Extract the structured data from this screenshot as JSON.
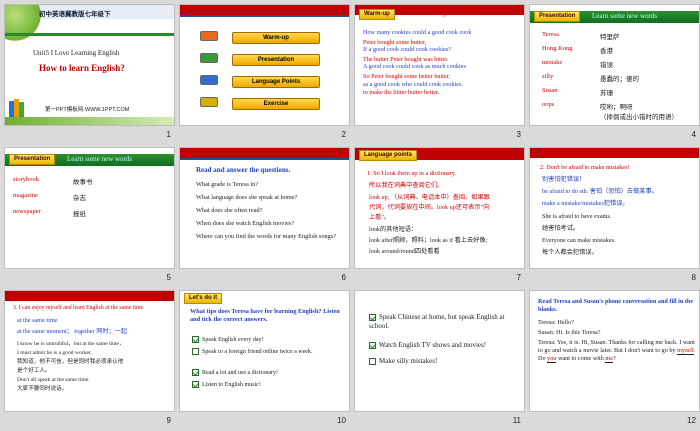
{
  "slides": [
    {
      "number": "1",
      "banner": "初中英语冀教版七年级下",
      "unit": "Unit5 I Love Learning English",
      "title": "How to learn English?",
      "footer": "第一PPT模板网-WWW.1PPT.COM"
    },
    {
      "number": "2",
      "menu": [
        "Warm-up",
        "Presentation",
        "Language Points",
        "Exercise"
      ]
    },
    {
      "number": "3",
      "tag": "Warm-up",
      "heading": "Tongue Twister",
      "lines": [
        "How many cookies could a good cook cook",
        "Peter bought some butter,",
        "If a good cook could cook cookies?",
        "The butter Peter bought was bitter.",
        "A good cook could cook as much cookies",
        "So Peter bought some better butter,",
        "as a good cook who could cook cookies.",
        "to make  the bitter butter better."
      ]
    },
    {
      "number": "4",
      "tag": "Presentation",
      "heading": "Learn some new words",
      "words": [
        {
          "en": "Teresa",
          "zh": "特里萨"
        },
        {
          "en": "Hong Kong",
          "zh": "香港"
        },
        {
          "en": "mistake",
          "zh": "错误"
        },
        {
          "en": "silly",
          "zh": "愚蠢的；傻的"
        },
        {
          "en": "Susan",
          "zh": "苏珊"
        },
        {
          "en": "oops",
          "zh": "哎哟；啊呀"
        }
      ],
      "note": "（摔倒或出小错时的用语）"
    },
    {
      "number": "5",
      "tag": "Presentation",
      "heading": "Learn some new words",
      "words": [
        {
          "en": "storybook",
          "zh": "故事书"
        },
        {
          "en": "magazine",
          "zh": "杂志"
        },
        {
          "en": "newspaper",
          "zh": "报纸"
        }
      ]
    },
    {
      "number": "6",
      "heading": "Read and answer the questions.",
      "questions": [
        "What grade is Teresa in?",
        "What language does she speak at home?",
        "What does she often read?",
        "When does she watch English movies?",
        "Where can you find the words for many English songs?"
      ]
    },
    {
      "number": "7",
      "tag": "Language points",
      "lines": [
        "1. So I look them up in a dictionary.",
        "所以我在词典中查阅它们。",
        "look up, （从词典、电话本中）查阅。如果跟",
        "代词，代词要放在中间。look up还可表示\"向",
        "上看\"。",
        "look的其他短语：",
        "look after照顾，照料；look as if 看上去好像;",
        "look around/round四处看看"
      ]
    },
    {
      "number": "8",
      "lines": [
        "2. Don't be afraid to make mistakes!",
        "别害怕犯错误！",
        "be afraid to do sth. 害怕（恐怕）去做某事。",
        "make a mistake/mistakes犯错误。",
        "She is afraid to have exams.",
        "她害怕考试。",
        "Everyone can make mistakes.",
        "每个人都会犯错误。"
      ]
    },
    {
      "number": "9",
      "lines": [
        "3. I can enjoy myself and learn English at the same time.",
        "at the same time",
        "at the same moment； together 同时；一起",
        "I know he is untruthful，but at the same time，",
        "I must admit he is a good worker.",
        "我知道，他不可信，但是同时我必须承认他",
        "是个好工人。",
        "Don't all speak at the same time.",
        "大家不要同时说话。"
      ]
    },
    {
      "number": "10",
      "tag": "Let's do it",
      "heading": "What tips does Teresa have for learning English?  Listen and  tick the correct answers.",
      "items": [
        {
          "text": "Speak English every day!",
          "checked": true
        },
        {
          "text": "Speak to a foreign friend online twice a week.",
          "checked": false
        },
        {
          "text": "Read a lot and use a dictionary!",
          "checked": true
        },
        {
          "text": "Listen to English music!",
          "checked": true
        }
      ]
    },
    {
      "number": "11",
      "items": [
        {
          "text": "Speak Chinese at home, but speak English  at school.",
          "checked": true
        },
        {
          "text": "Watch English  TV shows and movies!",
          "checked": true
        },
        {
          "text": "Make silly  mistakes!",
          "checked": false
        }
      ]
    },
    {
      "number": "12",
      "heading": "Read Teresa and Susan's phone conversation and  fill in the blanks.",
      "lines": [
        "Teresa: Hello?",
        "Susan: Hi. Is this Teresa?",
        "Teresa: Yes, it is. Hi, Susan. Thanks for calling me back. I want to go and watch a movie later. But I don't want to go by",
        "myself",
        ". Do",
        "you",
        "want to come with",
        "me",
        "?"
      ]
    }
  ],
  "colors": {
    "red": "#c00000",
    "blue": "#1f3fbf",
    "green": "#1f7f2f",
    "gold": "#e8b800"
  }
}
